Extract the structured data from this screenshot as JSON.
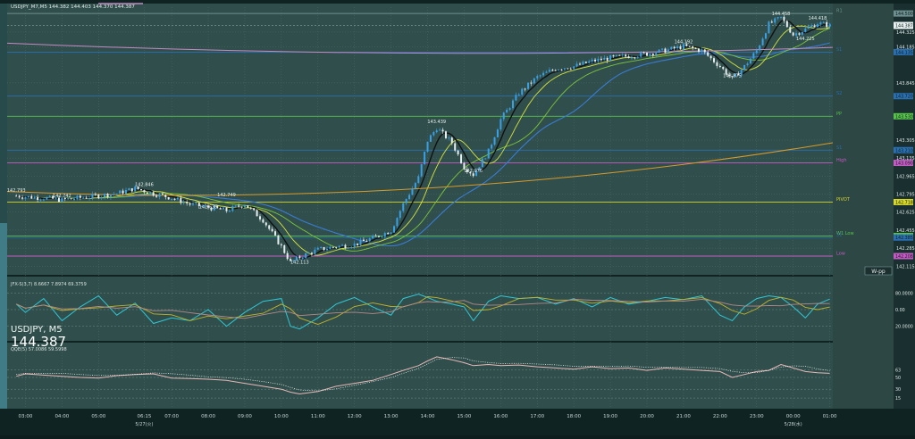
{
  "header": {
    "ohlc_text": "USDJPY_M7,M5  144.382 144.403 144.370 144.387",
    "symbol_tf": "USDJPY, M5",
    "last_price": "144.387"
  },
  "indicators": {
    "jfx_label": "JFX-S(3,7)  8.6667  7.8974  69.3759",
    "jfx_levels": [
      "80.0000",
      "0.00",
      "20.0000"
    ],
    "qqe_label": "QQE(5)  57.0086  59.5998",
    "qqe_levels": [
      "63",
      "50",
      "30",
      "15"
    ]
  },
  "price_axis_labels": [
    "144.325",
    "144.185",
    "143.845",
    "143.305",
    "143.135",
    "142.965",
    "142.795",
    "142.625",
    "142.455",
    "142.285",
    "142.115"
  ],
  "level_lines": [
    {
      "name": "R1",
      "label": "R1",
      "price": 144.5,
      "color": "#6e8f8f",
      "tag": "144.500"
    },
    {
      "name": "s1-upper",
      "label": "S1",
      "price": 144.135,
      "color": "#2a6fb0",
      "tag": "144.135"
    },
    {
      "name": "s2-upper",
      "label": "S2",
      "price": 143.72,
      "color": "#2a6fb0",
      "tag": "143.720"
    },
    {
      "name": "pp",
      "label": "PP",
      "price": 143.53,
      "color": "#57c24a",
      "tag": "143.530"
    },
    {
      "name": "s1",
      "label": "S1",
      "price": 143.21,
      "color": "#2a6fb0",
      "tag": "143.210"
    },
    {
      "name": "high",
      "label": "High",
      "price": 143.09,
      "color": "#c45bc4",
      "tag": "143.090"
    },
    {
      "name": "pivot",
      "label": "PIVOT",
      "price": 142.72,
      "color": "#d7d72a",
      "tag": "142.718"
    },
    {
      "name": "w1-low",
      "label": "W1 Low",
      "price": 142.4,
      "color": "#57c24a",
      "tag": "142.402"
    },
    {
      "name": "s1-lower",
      "label": "S1",
      "price": 142.385,
      "color": "#2a6fb0",
      "tag": "142.385"
    },
    {
      "name": "low",
      "label": "Low",
      "price": 142.21,
      "color": "#c45bc4",
      "tag": "142.208"
    }
  ],
  "w_pp_label": "W-pp",
  "time_axis_labels": [
    "03:00",
    "04:00",
    "05:00",
    "06:15",
    "07:00",
    "08:00",
    "09:00",
    "10:00",
    "11:00",
    "12:00",
    "13:00",
    "14:00",
    "15:00",
    "16:00",
    "17:00",
    "18:00",
    "19:00",
    "20:00",
    "21:00",
    "22:00",
    "23:00",
    "00:00",
    "01:00"
  ],
  "date_labels": [
    {
      "text": "5/27(火)",
      "at": "06:15"
    },
    {
      "text": "5/28(水)",
      "at": "00:00"
    }
  ],
  "chart_data": {
    "type": "line",
    "title": "USDJPY, M5",
    "ylim": [
      142.05,
      144.56
    ],
    "x": [
      "02:45",
      "03:00",
      "03:30",
      "04:00",
      "04:30",
      "05:00",
      "05:30",
      "06:00",
      "06:30",
      "07:00",
      "07:30",
      "08:00",
      "08:30",
      "09:00",
      "09:30",
      "10:00",
      "10:15",
      "10:30",
      "11:00",
      "11:30",
      "12:00",
      "12:30",
      "13:00",
      "13:20",
      "13:45",
      "14:00",
      "14:15",
      "14:40",
      "15:00",
      "15:15",
      "15:40",
      "16:00",
      "16:30",
      "17:00",
      "17:30",
      "18:00",
      "18:30",
      "19:00",
      "19:30",
      "20:00",
      "20:30",
      "21:00",
      "21:30",
      "22:00",
      "22:20",
      "22:40",
      "23:00",
      "23:20",
      "23:40",
      "00:00",
      "00:20",
      "00:40",
      "01:00"
    ],
    "series": [
      {
        "values": [
          142.78,
          142.77,
          142.76,
          142.74,
          142.76,
          142.78,
          142.8,
          142.85,
          142.8,
          142.76,
          142.7,
          142.67,
          142.64,
          142.7,
          142.55,
          142.3,
          142.15,
          142.2,
          142.27,
          142.3,
          142.32,
          142.38,
          142.45,
          142.7,
          142.95,
          143.3,
          143.42,
          143.28,
          143.05,
          142.98,
          143.2,
          143.5,
          143.75,
          143.9,
          143.98,
          144.0,
          144.05,
          144.08,
          144.1,
          144.12,
          144.15,
          144.19,
          144.15,
          144.0,
          143.88,
          144.0,
          144.15,
          144.4,
          144.46,
          144.3,
          144.35,
          144.41,
          144.387
        ]
      }
    ],
    "annotations": [
      {
        "text": "142.793",
        "x": "02:45",
        "y": 142.793
      },
      {
        "text": "142.742",
        "x": "04:00",
        "y": 142.742
      },
      {
        "text": "142.846",
        "x": "06:15",
        "y": 142.846
      },
      {
        "text": "142.636",
        "x": "08:00",
        "y": 142.636
      },
      {
        "text": "142.749",
        "x": "08:30",
        "y": 142.749
      },
      {
        "text": "142.113",
        "x": "10:30",
        "y": 142.113
      },
      {
        "text": "143.439",
        "x": "14:15",
        "y": 143.439
      },
      {
        "text": "142.976",
        "x": "15:15",
        "y": 142.976
      },
      {
        "text": "144.192",
        "x": "21:00",
        "y": 144.192
      },
      {
        "text": "143.875",
        "x": "22:20",
        "y": 143.875
      },
      {
        "text": "144.458",
        "x": "23:40",
        "y": 144.458
      },
      {
        "text": "144.225",
        "x": "00:20",
        "y": 144.225
      },
      {
        "text": "144.418",
        "x": "00:40",
        "y": 144.418
      }
    ],
    "jfx": [
      60,
      45,
      70,
      30,
      55,
      75,
      40,
      62,
      25,
      35,
      30,
      50,
      20,
      45,
      65,
      70,
      20,
      15,
      35,
      60,
      72,
      55,
      40,
      70,
      78,
      72,
      65,
      60,
      55,
      30,
      65,
      75,
      70,
      72,
      60,
      70,
      55,
      72,
      60,
      65,
      72,
      68,
      75,
      40,
      30,
      55,
      70,
      75,
      72,
      55,
      35,
      60,
      69
    ],
    "qqe": [
      52,
      56,
      54,
      52,
      50,
      49,
      53,
      55,
      56,
      49,
      48,
      47,
      45,
      40,
      35,
      30,
      25,
      22,
      26,
      35,
      40,
      45,
      55,
      62,
      70,
      78,
      85,
      80,
      75,
      70,
      72,
      70,
      71,
      68,
      66,
      64,
      68,
      65,
      66,
      62,
      66,
      64,
      62,
      60,
      50,
      55,
      60,
      62,
      72,
      66,
      60,
      58,
      57
    ]
  },
  "colors": {
    "bg": "#304f4c",
    "panel_bg": "#0f2323",
    "grid": "#4f6d6a",
    "bull": "#3aa0e6",
    "bear": "#e6eef0",
    "ma_black": "#111111",
    "ma_yellow": "#d9e23a",
    "ma_green": "#7cc43a",
    "ma_blue": "#3a7bd5",
    "ma_orange": "#d89a2a",
    "ma_pink": "#c48ac4"
  }
}
